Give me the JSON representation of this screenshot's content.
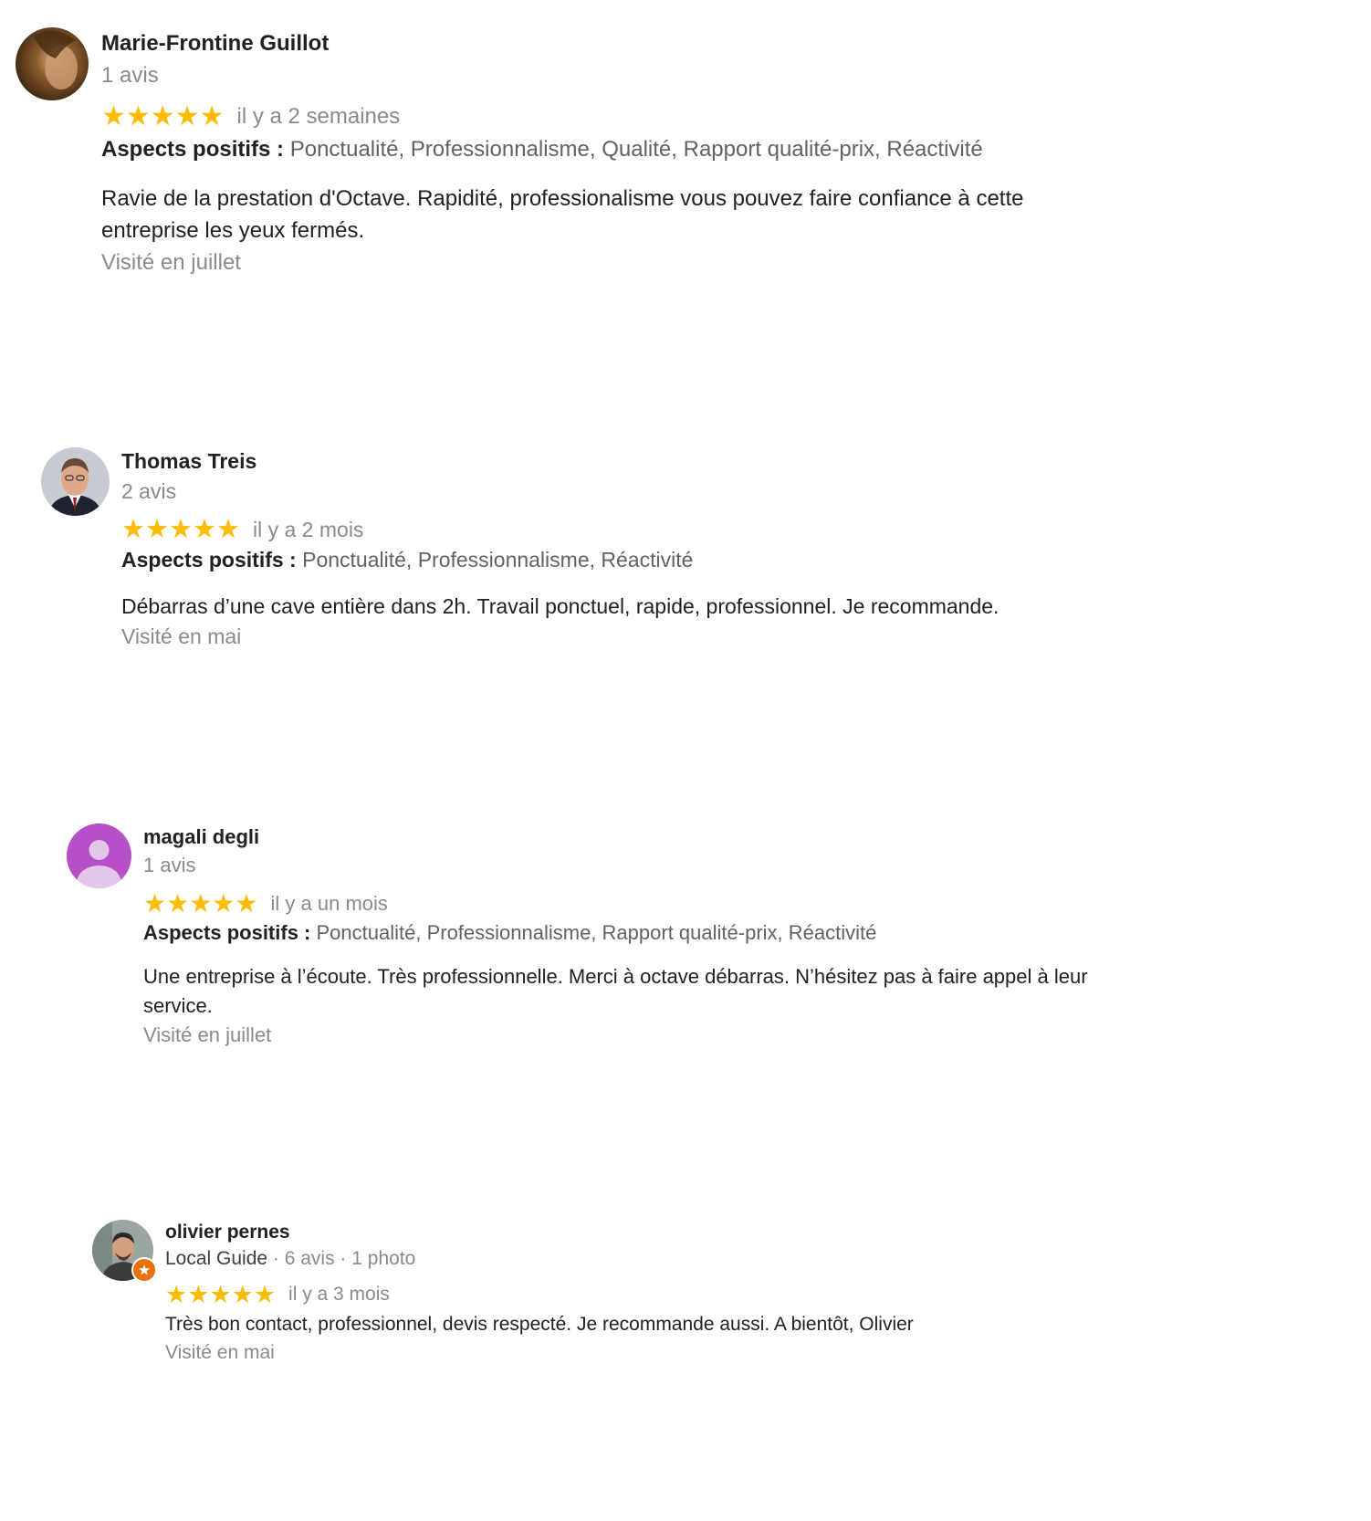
{
  "reviews": [
    {
      "name": "Marie-Frontine Guillot",
      "meta": "1 avis",
      "stars": "★★★★★",
      "rating": 5,
      "time": "il y a 2 semaines",
      "aspects_label": "Aspects positifs :",
      "aspects_values": "Ponctualité, Professionnalisme, Qualité, Rapport qualité-prix, Réactivité",
      "text": "Ravie de la prestation d'Octave. Rapidité, professionalisme vous pouvez faire confiance à cette entreprise les yeux fermés.",
      "visited": "Visité en juillet"
    },
    {
      "name": "Thomas Treis",
      "meta": "2 avis",
      "stars": "★★★★★",
      "rating": 5,
      "time": "il y a 2 mois",
      "aspects_label": "Aspects positifs :",
      "aspects_values": "Ponctualité, Professionnalisme, Réactivité",
      "text": "Débarras d’une cave entière dans 2h. Travail ponctuel, rapide, professionnel. Je recommande.",
      "visited": "Visité en mai"
    },
    {
      "name": "magali degli",
      "meta": "1 avis",
      "stars": "★★★★★",
      "rating": 5,
      "time": "il y a un mois",
      "aspects_label": "Aspects positifs :",
      "aspects_values": "Ponctualité, Professionnalisme, Rapport qualité-prix, Réactivité",
      "text": "Une entreprise à l’écoute. Très professionnelle. Merci à octave débarras. N’hésitez pas à faire appel à leur service.",
      "visited": "Visité en juillet"
    },
    {
      "name": "olivier pernes",
      "meta_guide": "Local Guide",
      "meta_rest": " · 6 avis · 1 photo",
      "stars": "★★★★★",
      "rating": 5,
      "time": "il y a 3 mois",
      "text": "Très bon contact, professionnel, devis respecté. Je recommande aussi. A bientôt, Olivier",
      "visited": "Visité en mai"
    }
  ],
  "colors": {
    "star": "#fbbc04",
    "placeholder_avatar": "#b64fc8",
    "local_guide_badge": "#e8710a"
  }
}
